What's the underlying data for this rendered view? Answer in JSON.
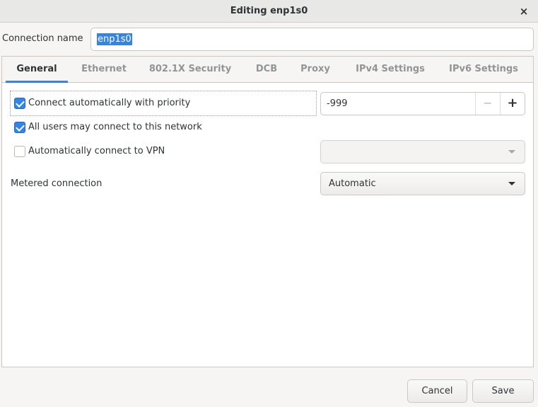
{
  "window": {
    "title": "Editing enp1s0"
  },
  "connection": {
    "label": "Connection name",
    "value": "enp1s0"
  },
  "tabs": [
    {
      "label": "General",
      "active": true
    },
    {
      "label": "Ethernet",
      "active": false
    },
    {
      "label": "802.1X Security",
      "active": false
    },
    {
      "label": "DCB",
      "active": false
    },
    {
      "label": "Proxy",
      "active": false
    },
    {
      "label": "IPv4 Settings",
      "active": false
    },
    {
      "label": "IPv6 Settings",
      "active": false
    }
  ],
  "general": {
    "auto_connect": {
      "label": "Connect automatically with priority",
      "checked": true
    },
    "priority": {
      "value": "-999",
      "minus": "−",
      "plus": "+"
    },
    "all_users": {
      "label": "All users may connect to this network",
      "checked": true
    },
    "auto_vpn": {
      "label": "Automatically connect to VPN",
      "checked": false,
      "selected": ""
    },
    "metered": {
      "label": "Metered connection",
      "selected": "Automatic"
    }
  },
  "footer": {
    "cancel_label": "Cancel",
    "save_label": "Save"
  },
  "icons": {
    "close": "×",
    "dropdown": "chevron-down-icon"
  },
  "colors": {
    "accent": "#3584e4"
  }
}
